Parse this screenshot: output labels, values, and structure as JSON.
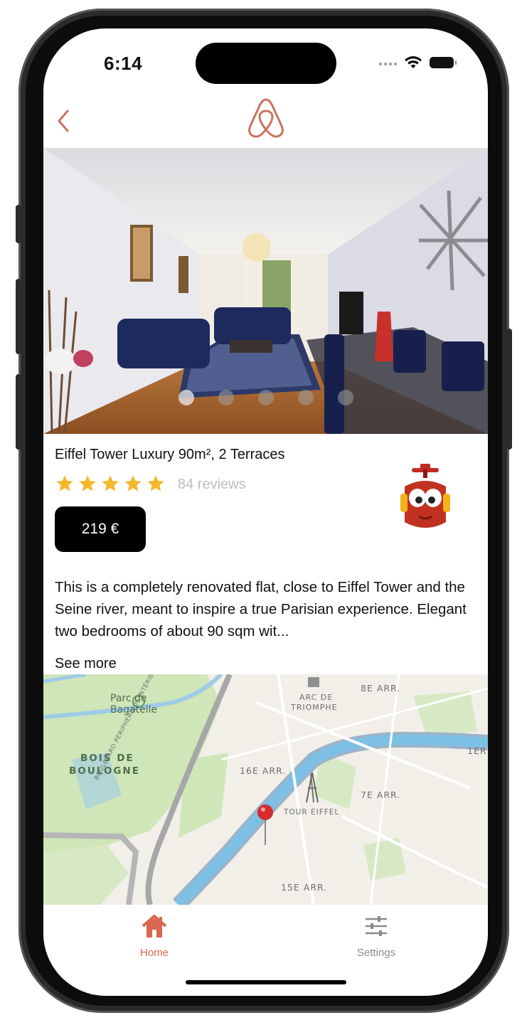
{
  "status_bar": {
    "time": "6:14"
  },
  "nav": {
    "back_icon": "chevron-left-icon",
    "logo_icon": "airbnb-logo-icon",
    "accent_color": "#c9735f"
  },
  "listing": {
    "title": "Eiffel Tower Luxury 90m², 2 Terraces",
    "rating": 5,
    "reviews": "84 reviews",
    "price": "219 €",
    "description": "This is a completely renovated flat, close to Eiffel Tower and the Seine river, meant to inspire a true Parisian experience. Elegant two bedrooms of about 90 sqm wit...",
    "see_more": "See more",
    "photo_count": 5,
    "active_photo": 0
  },
  "map": {
    "labels": {
      "parc": "Parc de",
      "parc2": "Bagatelle",
      "bois": "BOIS DE",
      "bois2": "BOULOGNE",
      "arc": "ARC DE",
      "arc2": "TRIOMPHE",
      "arr8": "8E ARR.",
      "arr16": "16E ARR.",
      "arr7": "7E ARR.",
      "arr15": "15E ARR.",
      "arr1": "1ER",
      "tour": "TOUR EIFFEL",
      "road": "BOULEVARD PÉRIPHÉRIQUE INTÉRIEUR"
    }
  },
  "tabbar": {
    "home": "Home",
    "settings": "Settings",
    "active_color": "#d8674e",
    "inactive_color": "#8a8a8a"
  }
}
